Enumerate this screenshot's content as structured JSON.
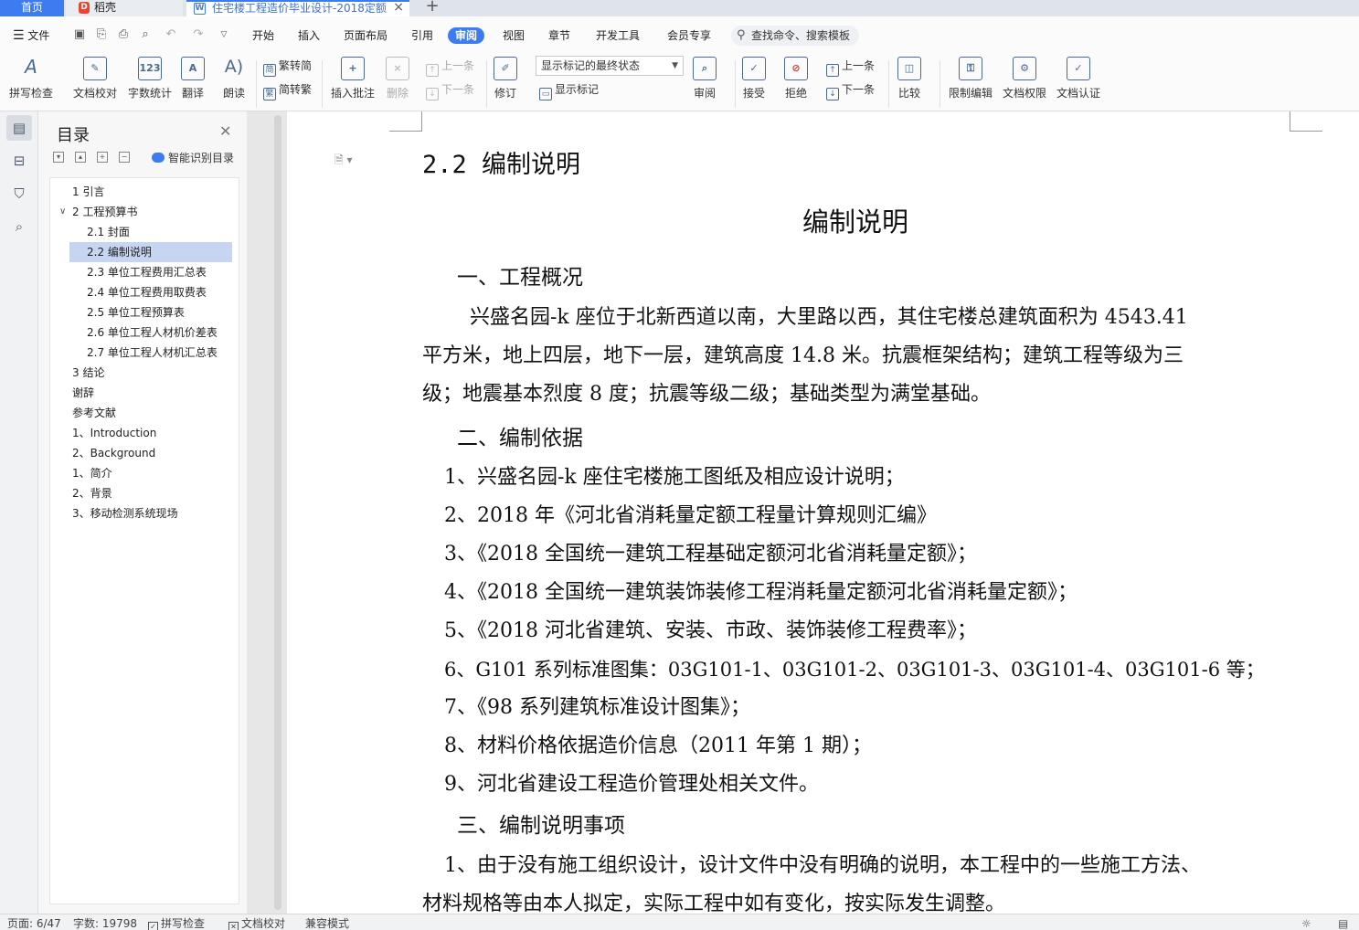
{
  "tabs": {
    "home": "首页",
    "daoke": "稻壳",
    "document": "住宅楼工程造价毕业设计-2018定额",
    "add": "+"
  },
  "menu": {
    "file": "文件",
    "items": [
      "开始",
      "插入",
      "页面布局",
      "引用",
      "审阅",
      "视图",
      "章节",
      "开发工具",
      "会员专享"
    ],
    "active": "审阅",
    "search_placeholder": "查找命令、搜索模板"
  },
  "toolbar": {
    "spell_check": "拼写检查",
    "doc_proof": "文档校对",
    "word_count": "字数统计",
    "translate": "翻译",
    "read_aloud": "朗读",
    "trad_to_simp": "繁转简",
    "simp_to_trad": "简转繁",
    "insert_comment": "插入批注",
    "delete": "删除",
    "prev_comment": "上一条",
    "next_comment": "下一条",
    "revise": "修订",
    "markup_state": "显示标记的最终状态",
    "show_markup": "显示标记",
    "review": "审阅",
    "accept": "接受",
    "reject": "拒绝",
    "prev_change": "上一条",
    "next_change": "下一条",
    "compare": "比较",
    "restrict_edit": "限制编辑",
    "doc_permission": "文档权限",
    "doc_cert": "文档认证"
  },
  "toc": {
    "title": "目录",
    "smart": "智能识别目录",
    "items": [
      {
        "label": "1 引言",
        "level": 0
      },
      {
        "label": "2 工程预算书",
        "level": 0,
        "expanded": true
      },
      {
        "label": "2.1 封面",
        "level": 1
      },
      {
        "label": "2.2 编制说明",
        "level": 1,
        "selected": true
      },
      {
        "label": "2.3 单位工程费用汇总表",
        "level": 1
      },
      {
        "label": "2.4 单位工程费用取费表",
        "level": 1
      },
      {
        "label": "2.5 单位工程预算表",
        "level": 1
      },
      {
        "label": "2.6 单位工程人材机价差表",
        "level": 1
      },
      {
        "label": "2.7 单位工程人材机汇总表",
        "level": 1
      },
      {
        "label": "3 结论",
        "level": 0
      },
      {
        "label": "谢辞",
        "level": 0
      },
      {
        "label": "参考文献",
        "level": 0
      },
      {
        "label": "1、Introduction",
        "level": 0
      },
      {
        "label": "2、Background",
        "level": 0
      },
      {
        "label": "1、简介",
        "level": 0
      },
      {
        "label": "2、背景",
        "level": 0
      },
      {
        "label": "3、移动检测系统现场",
        "level": 0
      }
    ]
  },
  "document": {
    "heading": "2.2 编制说明",
    "title": "编制说明",
    "sec1": "一、工程概况",
    "p1_l1": "兴盛名园-k 座位于北新西道以南，大里路以西，其住宅楼总建筑面积为 4543.41",
    "p1_l2": "平方米，地上四层，地下一层，建筑高度 14.8 米。抗震框架结构；建筑工程等级为三",
    "p1_l3": "级；地震基本烈度 8 度；抗震等级二级；基础类型为满堂基础。",
    "sec2": "二、编制依据",
    "list": [
      "1、兴盛名园-k 座住宅楼施工图纸及相应设计说明；",
      "2、2018 年《河北省消耗量定额工程量计算规则汇编》",
      "3、《2018 全国统一建筑工程基础定额河北省消耗量定额》；",
      "4、《2018 全国统一建筑装饰装修工程消耗量定额河北省消耗量定额》；",
      "5、《2018 河北省建筑、安装、市政、装饰装修工程费率》；",
      "6、G101 系列标准图集：03G101-1、03G101-2、03G101-3、03G101-4、03G101-6 等；",
      "7、《98 系列建筑标准设计图集》；",
      "8、材料价格依据造价信息（2011 年第 1 期）；",
      "9、河北省建设工程造价管理处相关文件。"
    ],
    "sec3": "三、编制说明事项",
    "p3_l1": "1、由于没有施工组织设计，设计文件中没有明确的说明，本工程中的一些施工方法、",
    "p3_l2": "材料规格等由本人拟定，实际工程中如有变化，按实际发生调整。"
  },
  "status": {
    "page": "页面: 6/47",
    "words": "字数: 19798",
    "spell": "拼写检查",
    "proof": "文档校对",
    "compat": "兼容模式"
  }
}
